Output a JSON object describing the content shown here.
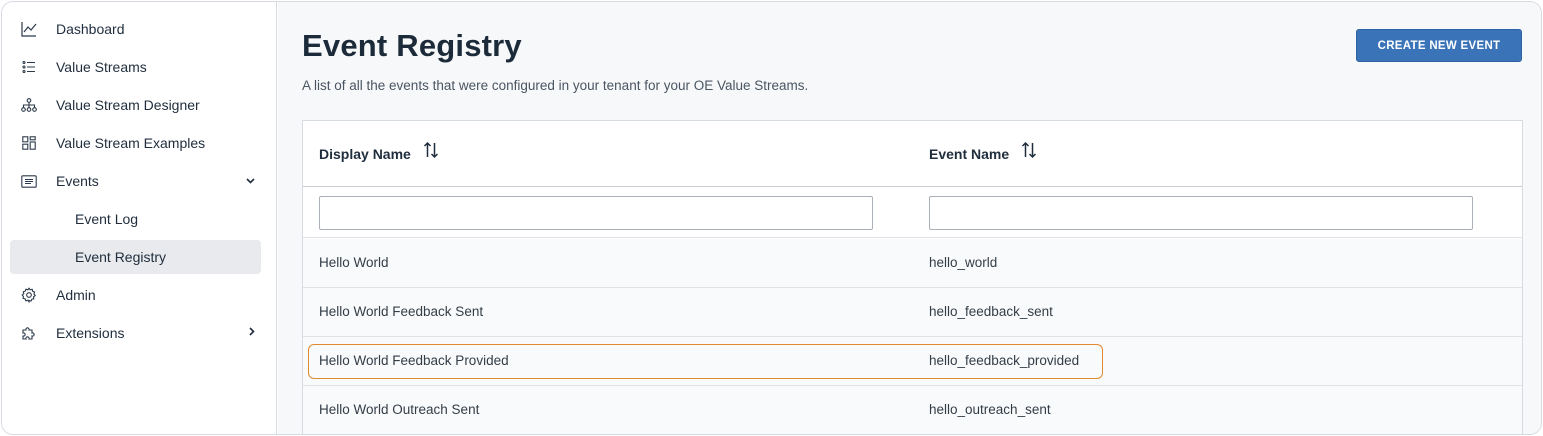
{
  "sidebar": {
    "items": [
      {
        "label": "Dashboard",
        "icon": "chart-line-icon"
      },
      {
        "label": "Value Streams",
        "icon": "list-icon"
      },
      {
        "label": "Value Stream Designer",
        "icon": "hierarchy-icon"
      },
      {
        "label": "Value Stream Examples",
        "icon": "grid-icon"
      },
      {
        "label": "Events",
        "icon": "events-icon",
        "expanded": true
      },
      {
        "label": "Event Log",
        "sub": true
      },
      {
        "label": "Event Registry",
        "sub": true,
        "active": true
      },
      {
        "label": "Admin",
        "icon": "gear-icon"
      },
      {
        "label": "Extensions",
        "icon": "puzzle-icon",
        "expanded": false
      }
    ]
  },
  "main": {
    "title": "Event Registry",
    "description": "A list of all the events that were configured in your tenant for your OE Value Streams.",
    "create_button": "CREATE NEW EVENT"
  },
  "table": {
    "columns": [
      "Display Name",
      "Event Name"
    ],
    "filters": [
      "",
      ""
    ],
    "rows": [
      {
        "display_name": "Hello World",
        "event_name": "hello_world"
      },
      {
        "display_name": "Hello World Feedback Sent",
        "event_name": "hello_feedback_sent"
      },
      {
        "display_name": "Hello World Feedback Provided",
        "event_name": "hello_feedback_provided",
        "highlighted": true
      },
      {
        "display_name": "Hello World Outreach Sent",
        "event_name": "hello_outreach_sent"
      }
    ]
  },
  "colors": {
    "accent": "#3b73b8",
    "highlight": "#e08a2e",
    "active_nav": "#e8eaed"
  }
}
